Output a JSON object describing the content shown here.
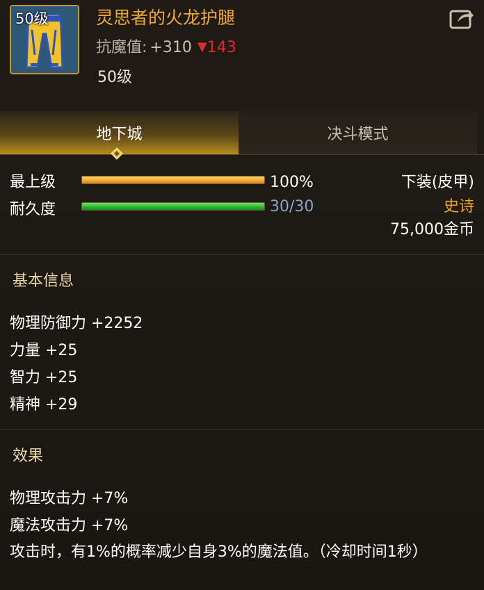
{
  "item": {
    "level_badge": "50级",
    "name": "灵思者的火龙护腿",
    "resist_label": "抗魔值:",
    "resist_value": "+310",
    "resist_diff_arrow": "▼",
    "resist_diff": "143",
    "level_requirement": "50级",
    "icon": "leather-pants-icon",
    "share_icon": "share-icon"
  },
  "tabs": [
    {
      "label": "地下城",
      "active": true
    },
    {
      "label": "决斗模式",
      "active": false
    }
  ],
  "bars": {
    "upgrade": {
      "label": "最上级",
      "value_text": "100%",
      "fraction": 1.0
    },
    "durability": {
      "label": "耐久度",
      "value_text": "30/30",
      "fraction": 1.0
    }
  },
  "info": {
    "slot_type": "下装(皮甲)",
    "rarity": "史诗",
    "price": "75,000金币"
  },
  "basic_info": {
    "title": "基本信息",
    "stats": [
      "物理防御力 +2252",
      "力量 +25",
      "智力 +25",
      "精神 +29"
    ]
  },
  "effects": {
    "title": "效果",
    "lines": [
      "物理攻击力 +7%",
      "魔法攻击力 +7%"
    ],
    "description": "攻击时，有1%的概率减少自身3%的魔法值。（冷却时间1秒）"
  },
  "colors": {
    "item_name": "#f0a92e",
    "rarity_epic": "#f2a723",
    "diff_down": "#e02b2b",
    "durability_value": "#8ea3c8"
  }
}
